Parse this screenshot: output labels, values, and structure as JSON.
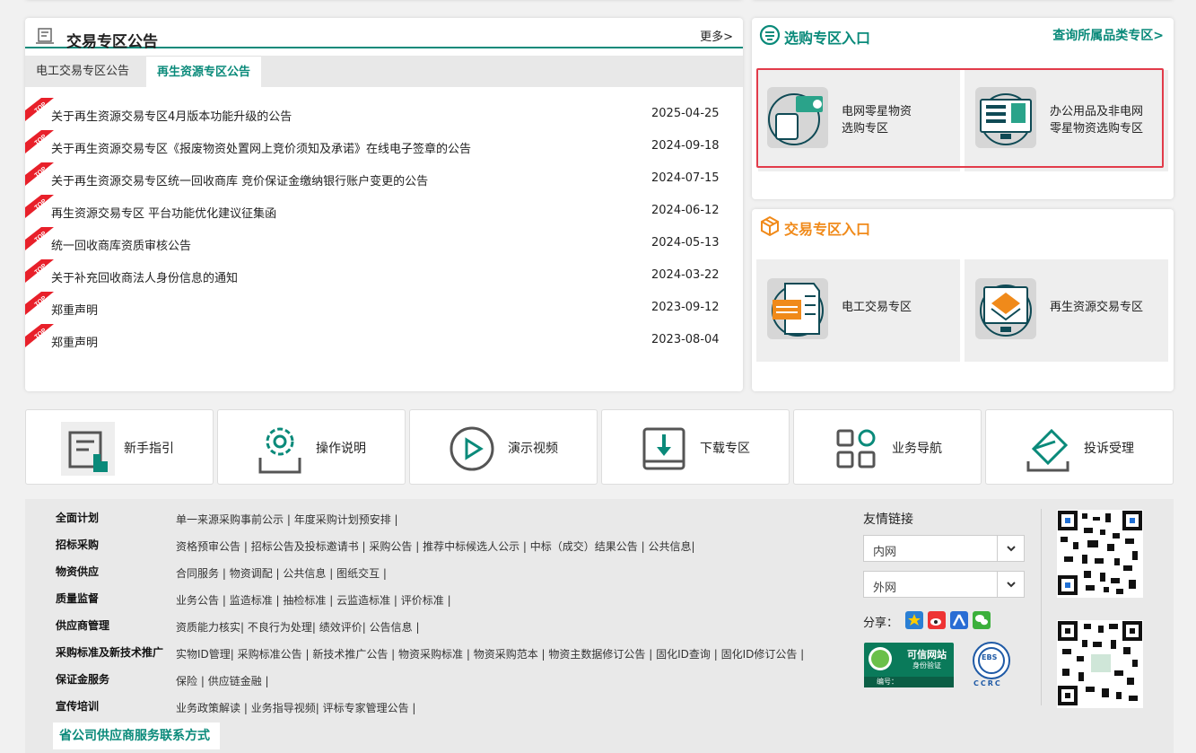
{
  "announcements": {
    "title": "交易专区公告",
    "more": "更多>",
    "tabs": [
      "电工交易专区公告",
      "再生资源专区公告"
    ],
    "active_tab": 1,
    "badge": "TOP",
    "items": [
      {
        "title": "关于再生资源交易专区4月版本功能升级的公告",
        "date": "2025-04-25"
      },
      {
        "title": "关于再生资源交易专区《报废物资处置网上竞价须知及承诺》在线电子签章的公告",
        "date": "2024-09-18"
      },
      {
        "title": "关于再生资源交易专区统一回收商库 竞价保证金缴纳银行账户变更的公告",
        "date": "2024-07-15"
      },
      {
        "title": "再生资源交易专区 平台功能优化建议征集函",
        "date": "2024-06-12"
      },
      {
        "title": "统一回收商库资质审核公告",
        "date": "2024-05-13"
      },
      {
        "title": "关于补充回收商法人身份信息的通知",
        "date": "2024-03-22"
      },
      {
        "title": "郑重声明",
        "date": "2023-09-12"
      },
      {
        "title": "郑重声明",
        "date": "2023-08-04"
      }
    ]
  },
  "select_zone": {
    "title": "选购专区入口",
    "link": "查询所属品类专区>",
    "tiles": [
      {
        "label_l1": "电网零星物资",
        "label_l2": "选购专区",
        "icon": "hand-card-icon"
      },
      {
        "label_l1": "办公用品及非电网",
        "label_l2": "零星物资选购专区",
        "icon": "monitor-doc-icon"
      }
    ]
  },
  "trade_zone": {
    "title": "交易专区入口",
    "tiles": [
      {
        "label": "电工交易专区",
        "icon": "receipt-icon"
      },
      {
        "label": "再生资源交易专区",
        "icon": "layers-icon"
      }
    ]
  },
  "quick": [
    {
      "label": "新手指引",
      "icon": "guide-icon"
    },
    {
      "label": "操作说明",
      "icon": "settings-icon"
    },
    {
      "label": "演示视频",
      "icon": "play-icon"
    },
    {
      "label": "下载专区",
      "icon": "download-icon"
    },
    {
      "label": "业务导航",
      "icon": "grid-icon"
    },
    {
      "label": "投诉受理",
      "icon": "mail-icon"
    }
  ],
  "footer": {
    "rows": [
      {
        "cat": "全面计划",
        "links": [
          "单一来源采购事前公示 |",
          "年度采购计划预安排 |"
        ]
      },
      {
        "cat": "招标采购",
        "links": [
          "资格预审公告 |",
          "招标公告及投标邀请书 |",
          "采购公告 |",
          "推荐中标候选人公示 |",
          "中标（成交）结果公告 |",
          "公共信息|"
        ]
      },
      {
        "cat": "物资供应",
        "links": [
          "合同服务 |",
          "物资调配 |",
          "公共信息 |",
          "图纸交互 |"
        ]
      },
      {
        "cat": "质量监督",
        "links": [
          "业务公告 |",
          "监造标准 |",
          "抽检标准 |",
          "云监造标准 |",
          "评价标准 |"
        ]
      },
      {
        "cat": "供应商管理",
        "links": [
          "资质能力核实|",
          "不良行为处理|",
          "绩效评价|",
          "公告信息 |"
        ]
      },
      {
        "cat": "采购标准及新技术推广",
        "links": [
          "实物ID管理|",
          "采购标准公告 |",
          "新技术推广公告 |",
          "物资采购标准 |",
          "物资采购范本 |",
          "物资主数据修订公告 |",
          "固化ID查询 |",
          "固化ID修订公告 |"
        ]
      },
      {
        "cat": "保证金服务",
        "links": [
          "保险 |",
          "供应链金融 |"
        ]
      },
      {
        "cat": "宣传培训",
        "links": [
          "业务政策解读 |",
          "业务指导视频|",
          "评标专家管理公告 |"
        ]
      }
    ],
    "contact": "省公司供应商服务联系方式",
    "friend_title": "友情链接",
    "select_inner": "内网",
    "select_outer": "外网",
    "share_label": "分享：",
    "badge_text": "可信网站",
    "badge_sub": "身份验证",
    "badge_no": "编号：",
    "ccrc": "CCRC",
    "ebs": "EBS"
  },
  "colors": {
    "accent": "#0a8a7a",
    "orange": "#f08a1a",
    "red": "#e23b4a",
    "badge_red": "#e8202a"
  }
}
